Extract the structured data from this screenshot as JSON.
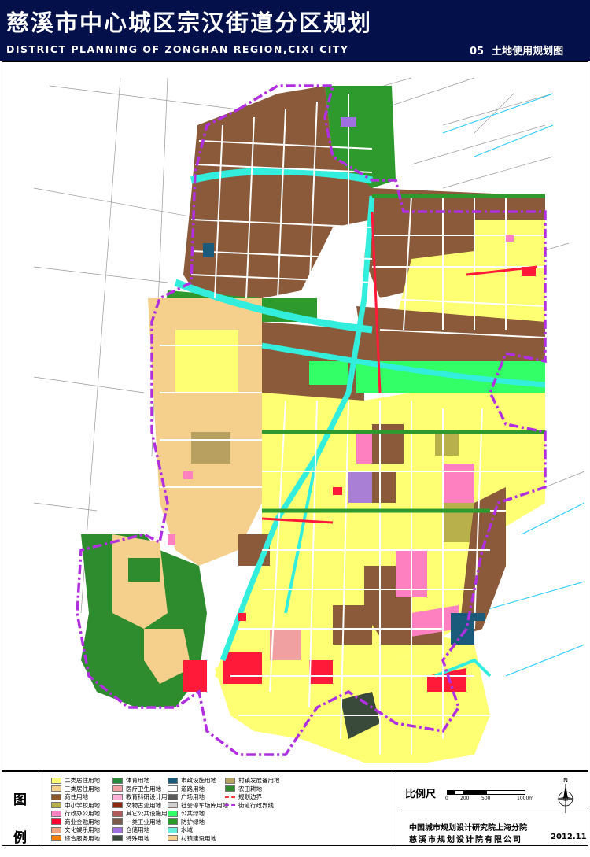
{
  "header": {
    "title_cn": "慈溪市中心城区宗汉街道分区规划",
    "title_en": "DISTRICT PLANNING OF ZONGHAN REGION,CIXI CITY",
    "sheet_no": "05",
    "sheet_name": "土地使用规划图"
  },
  "legend": {
    "title_top": "图",
    "title_bottom": "例",
    "items": [
      {
        "label": "二类居住用地",
        "color": "#ffff73"
      },
      {
        "label": "三类居住用地",
        "color": "#f5d08c"
      },
      {
        "label": "商住用地",
        "color": "#8c5a2a"
      },
      {
        "label": "中小学校用地",
        "color": "#b8b04a"
      },
      {
        "label": "行政办公用地",
        "color": "#ff80c0"
      },
      {
        "label": "商业金融用地",
        "color": "#ff0033"
      },
      {
        "label": "文化娱乐用地",
        "color": "#f2a27a"
      },
      {
        "label": "综合服务用地",
        "color": "#ff7f00"
      },
      {
        "label": "体育用地",
        "color": "#2a8a3a"
      },
      {
        "label": "医疗卫生用地",
        "color": "#f0a0a0"
      },
      {
        "label": "教育科研设计用地",
        "color": "#ffb0d8"
      },
      {
        "label": "文物古迹用地",
        "color": "#8a2a10"
      },
      {
        "label": "其它公共设施用地",
        "color": "#b05a5a"
      },
      {
        "label": "一类工业用地",
        "color": "#7a5a4a"
      },
      {
        "label": "仓储用地",
        "color": "#a070e0"
      },
      {
        "label": "特殊用地",
        "color": "#3a4a3a"
      },
      {
        "label": "市政设施用地",
        "color": "#1a5a7a"
      },
      {
        "label": "道路用地",
        "color": "#ffffff"
      },
      {
        "label": "广场用地",
        "color": "#5a5a5a"
      },
      {
        "label": "社会停车场库用地",
        "color": "#d0d0d0"
      },
      {
        "label": "公共绿地",
        "color": "#33ff66"
      },
      {
        "label": "防护绿地",
        "color": "#2a9a2a"
      },
      {
        "label": "水域",
        "color": "#66eedd"
      },
      {
        "label": "村镇建设用地",
        "color": "#f5d08c"
      },
      {
        "label": "村镇发展备用地",
        "color": "#b8a060"
      },
      {
        "label": "农田耕地",
        "color": "#2e8b2e"
      },
      {
        "label": "规划边界",
        "color": "#ff3333"
      },
      {
        "label": "街道行政界线",
        "color": "#b030e0"
      }
    ]
  },
  "scale": {
    "title": "比例尺",
    "ticks": [
      "0",
      "200",
      "500",
      "1000m"
    ]
  },
  "north": {
    "label": "N",
    "icon": "north-arrow-icon"
  },
  "footer": {
    "org1": "中国城市规划设计研究院上海分院",
    "org2": "慈溪市规划设计院有限公司",
    "date": "2012.11"
  },
  "map": {
    "colors": {
      "commercial_residential": "#8a5a3a",
      "residential": "#ffff73",
      "village": "#f5d08c",
      "green": "#2e9a2e",
      "public_green": "#33ff66",
      "water": "#33eedd",
      "boundary": "#b030e0",
      "commercial": "#ff1a3a",
      "road": "#ffffff"
    }
  }
}
